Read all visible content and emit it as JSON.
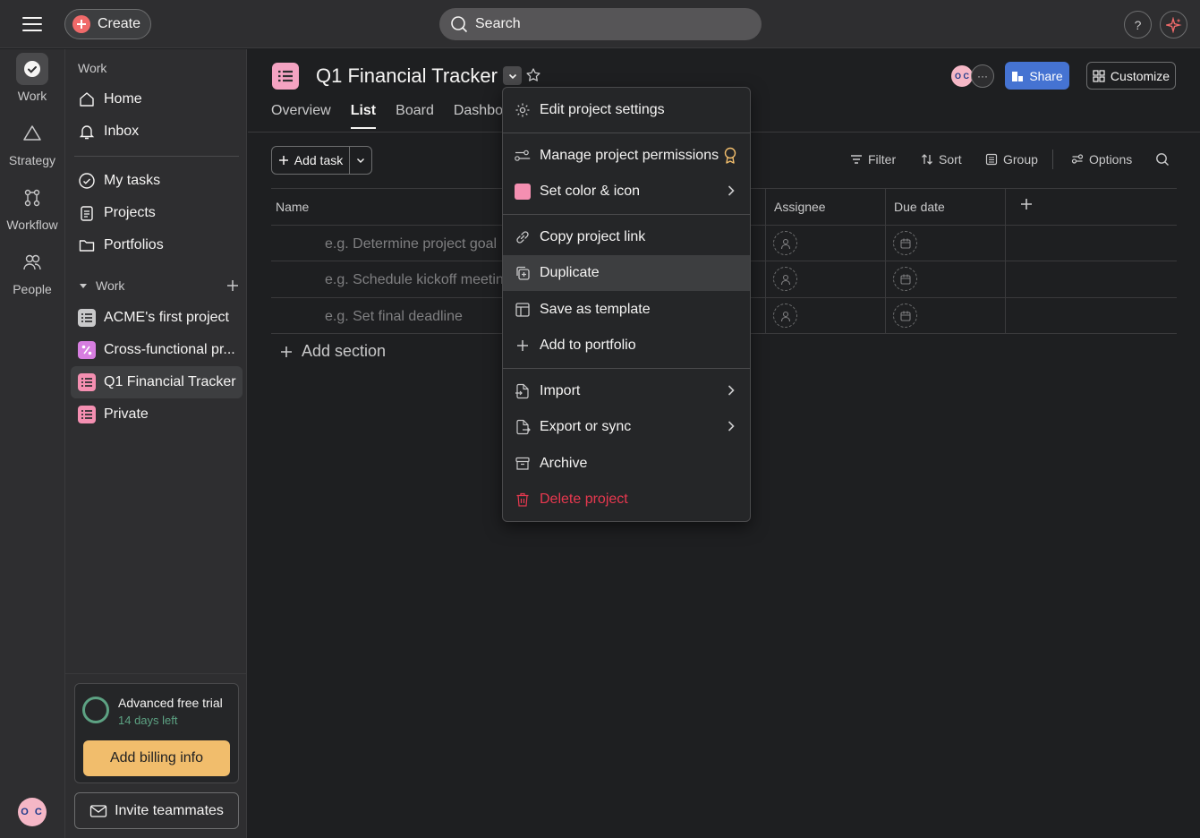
{
  "topbar": {
    "create_label": "Create",
    "search_placeholder": "Search",
    "help_label": "?"
  },
  "rail": {
    "items": [
      {
        "label": "Work"
      },
      {
        "label": "Strategy"
      },
      {
        "label": "Workflow"
      },
      {
        "label": "People"
      }
    ],
    "avatar_initials": "O C"
  },
  "sidebar": {
    "header": "Work",
    "nav": [
      {
        "label": "Home"
      },
      {
        "label": "Inbox"
      },
      {
        "label": "My tasks"
      },
      {
        "label": "Projects"
      },
      {
        "label": "Portfolios"
      }
    ],
    "section_label": "Work",
    "projects": [
      {
        "label": "ACME's first project",
        "color": "#c9c9ca"
      },
      {
        "label": "Cross-functional pr...",
        "color": "#d77ee0"
      },
      {
        "label": "Q1 Financial Tracker",
        "color": "#f48fb1"
      },
      {
        "label": "Private",
        "color": "#f48fb1"
      }
    ],
    "trial": {
      "title": "Advanced free trial",
      "days_left": "14 days left",
      "billing_button": "Add billing info"
    },
    "invite_button": "Invite teammates"
  },
  "project": {
    "title": "Q1 Financial Tracker",
    "icon_color": "#f4a3c2",
    "tabs": [
      {
        "label": "Overview",
        "active": false
      },
      {
        "label": "List",
        "active": true
      },
      {
        "label": "Board",
        "active": false
      },
      {
        "label": "Dashboa",
        "active": false
      }
    ],
    "header_avatar_initials": "O C",
    "share_label": "Share",
    "customize_label": "Customize"
  },
  "list": {
    "add_task_label": "Add task",
    "toolbar": {
      "filter": "Filter",
      "sort": "Sort",
      "group": "Group",
      "options": "Options"
    },
    "columns": {
      "name": "Name",
      "assignee": "Assignee",
      "due_date": "Due date"
    },
    "rows": [
      {
        "name": "e.g. Determine project goal"
      },
      {
        "name": "e.g. Schedule kickoff meeting"
      },
      {
        "name": "e.g. Set final deadline"
      }
    ],
    "add_section_label": "Add section"
  },
  "menu": {
    "items": {
      "edit_settings": "Edit project settings",
      "permissions": "Manage project permissions",
      "set_color": "Set color & icon",
      "copy_link": "Copy project link",
      "duplicate": "Duplicate",
      "save_template": "Save as template",
      "add_portfolio": "Add to portfolio",
      "import": "Import",
      "export": "Export or sync",
      "archive": "Archive",
      "delete": "Delete project"
    }
  },
  "colors": {
    "background": "#1e1f21",
    "panel": "#2e2e30",
    "accent_blue": "#4573d2",
    "billing": "#f1bd6c",
    "danger": "#e8384f",
    "trial_green": "#5da283"
  }
}
